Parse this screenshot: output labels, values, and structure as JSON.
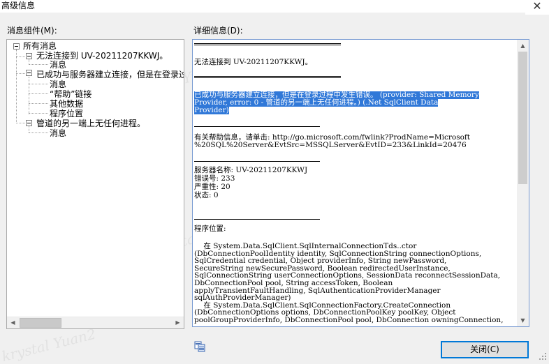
{
  "window": {
    "title": "高级信息",
    "close_glyph": "✕"
  },
  "left_label": "消息组件(M):",
  "right_label": "详细信息(D):",
  "tree": {
    "root": "所有消息",
    "items": [
      {
        "label": "无法连接到 UV-20211207KKWJ。",
        "children": [
          "消息"
        ]
      },
      {
        "label": "已成功与服务器建立连接，但是在登录过程中发生错误。",
        "children": [
          "消息",
          "“帮助”链接",
          "其他数据",
          "程序位置"
        ]
      },
      {
        "label": "管道的另一端上无任何进程。",
        "children": [
          "消息"
        ]
      }
    ]
  },
  "details": {
    "line1": "无法连接到 UV-20211207KKWJ。",
    "hl1": "已成功与服务器建立连接，但是在登录过程中发生错误。 (provider: Shared Memory",
    "hl2": "Provider, error: 0 - 管道的另一端上无任何进程。) (.Net SqlClient Data",
    "hl3": "Provider)",
    "help1": "有关帮助信息，请单击: http://go.microsoft.com/fwlink?ProdName=Microsoft",
    "help2": "%20SQL%20Server&EvtSrc=MSSQLServer&EvtID=233&LinkId=20476",
    "server": "服务器名称: UV-20211207KKWJ",
    "error": "错误号: 233",
    "severity": "严重性: 20",
    "state": "状态: 0",
    "loc_title": "程序位置:",
    "code": [
      "    在 System.Data.SqlClient.SqlInternalConnectionTds..ctor",
      "(DbConnectionPoolIdentity identity, SqlConnectionString connectionOptions,",
      "SqlCredential credential, Object providerInfo, String newPassword,",
      "SecureString newSecurePassword, Boolean redirectedUserInstance,",
      "SqlConnectionString userConnectionOptions, SessionData reconnectSessionData,",
      "DbConnectionPool pool, String accessToken, Boolean",
      "applyTransientFaultHandling, SqlAuthenticationProviderManager",
      "sqlAuthProviderManager)",
      "    在 System.Data.SqlClient.SqlConnectionFactory.CreateConnection",
      "(DbConnectionOptions options, DbConnectionPoolKey poolKey, Object",
      "poolGroupProviderInfo, DbConnectionPool pool, DbConnection owningConnection,"
    ]
  },
  "close_button": "关闭(C)",
  "watermark": "krystal Yuan2"
}
